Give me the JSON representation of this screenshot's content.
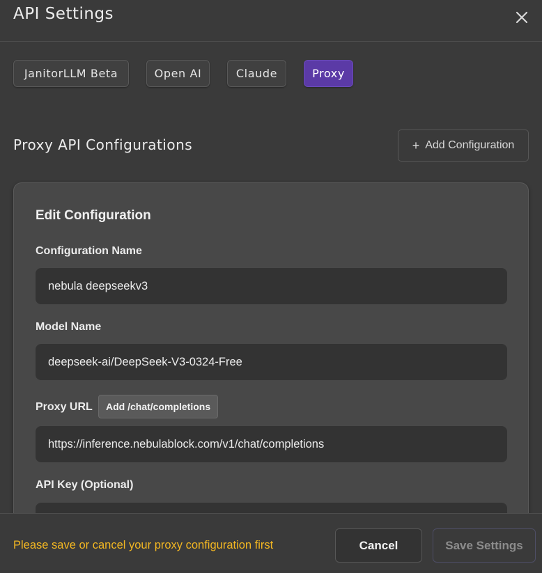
{
  "header": {
    "title": "API Settings",
    "close_icon": "close-icon"
  },
  "tabs": [
    {
      "label": "JanitorLLM Beta",
      "active": false
    },
    {
      "label": "Open AI",
      "active": false
    },
    {
      "label": "Claude",
      "active": false
    },
    {
      "label": "Proxy",
      "active": true
    }
  ],
  "section": {
    "title": "Proxy API Configurations",
    "add_button_icon": "+",
    "add_button_label": "Add Configuration"
  },
  "edit_config": {
    "title": "Edit Configuration",
    "configuration_name": {
      "label": "Configuration Name",
      "value": "nebula deepseekv3"
    },
    "model_name": {
      "label": "Model Name",
      "value": "deepseek-ai/DeepSeek-V3-0324-Free"
    },
    "proxy_url": {
      "label": "Proxy URL",
      "inline_button": "Add /chat/completions",
      "value": "https://inference.nebulablock.com/v1/chat/completions"
    },
    "api_key": {
      "label": "API Key (Optional)",
      "value": ""
    }
  },
  "footer": {
    "warning": "Please save or cancel your proxy configuration first",
    "cancel_label": "Cancel",
    "save_label": "Save Settings"
  },
  "colors": {
    "background": "#3a3a3a",
    "card": "#484848",
    "input": "#333333",
    "accent": "#5b3aa6",
    "warning": "#f3b722"
  }
}
